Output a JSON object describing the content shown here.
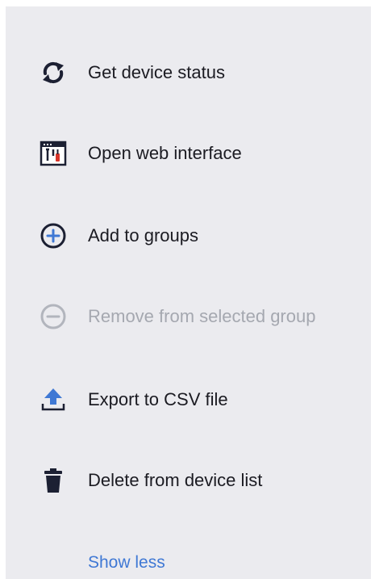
{
  "colors": {
    "panel_background": "#ebebef",
    "text": "#1b1b22",
    "icon_dark": "#1c2033",
    "disabled": "#a5a8b0",
    "accent_blue": "#3f78d4",
    "link": "#3f78d4"
  },
  "menu": {
    "items": [
      {
        "label": "Get device status",
        "icon": "refresh-icon",
        "enabled": true
      },
      {
        "label": "Open web interface",
        "icon": "web-interface-icon",
        "enabled": true
      },
      {
        "label": "Add to groups",
        "icon": "add-circle-icon",
        "enabled": true
      },
      {
        "label": "Remove from selected group",
        "icon": "remove-circle-icon",
        "enabled": false
      },
      {
        "label": "Export to CSV file",
        "icon": "export-upload-icon",
        "enabled": true
      },
      {
        "label": "Delete from device list",
        "icon": "trash-icon",
        "enabled": true
      }
    ],
    "show_less_label": "Show less"
  }
}
